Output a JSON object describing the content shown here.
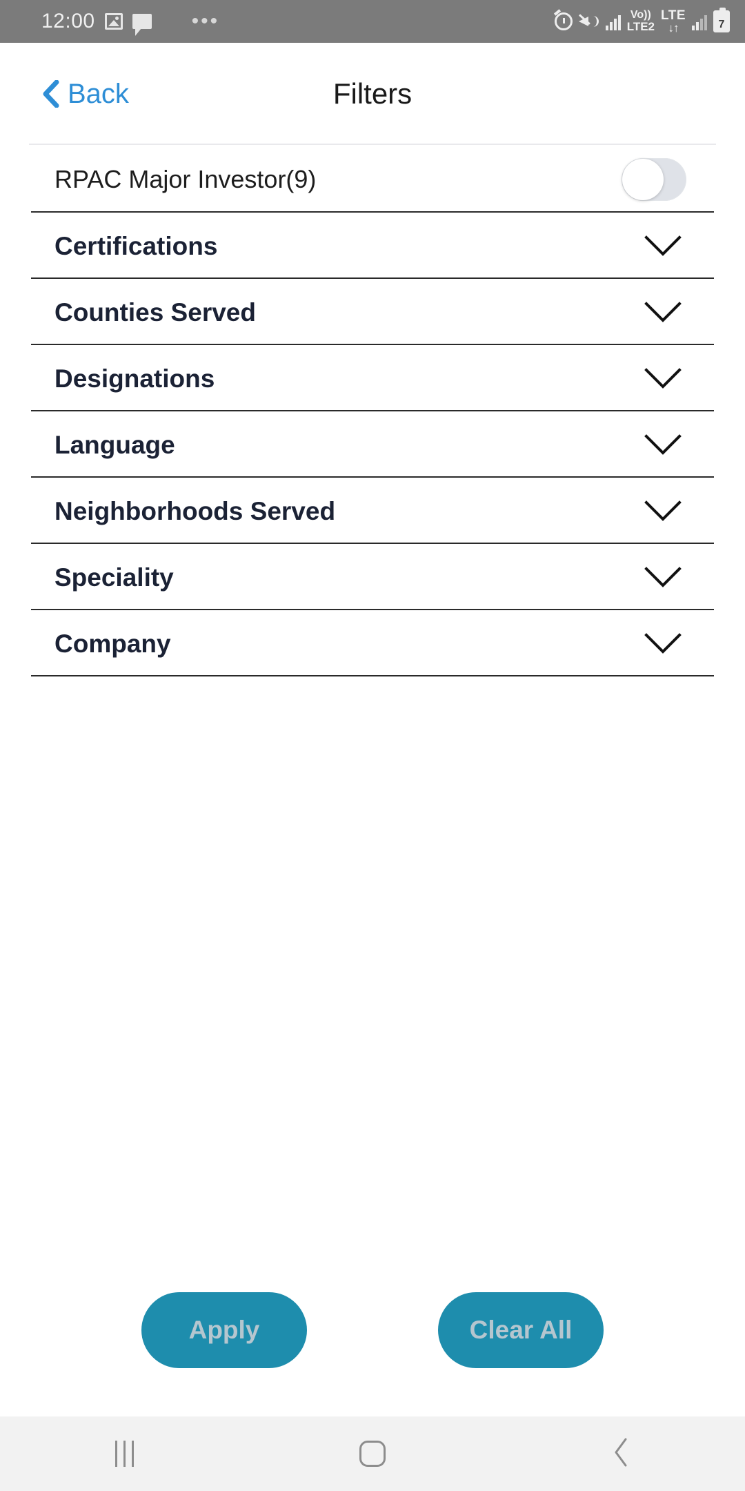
{
  "status_bar": {
    "time": "12:00",
    "left_icons": [
      "photo-icon",
      "chat-icon"
    ],
    "overflow": "•••",
    "right_icons": [
      "alarm-icon",
      "mute-vibrate-icon",
      "signal-bars-icon",
      "volte2-icon",
      "lte-data-icon",
      "signal-bars-2-icon",
      "battery-icon"
    ],
    "volte_top": "Vo))",
    "volte_bottom": "LTE2",
    "lte_label": "LTE",
    "lte_arrows": "↓↑",
    "battery_level": "7",
    "background": "#7b7b7b"
  },
  "header": {
    "back_label": "Back",
    "back_icon": "chevron-left-icon",
    "title": "Filters",
    "accent": "#2e8ed6"
  },
  "filters": {
    "toggle_row": {
      "label": "RPAC Major Investor(9)",
      "toggle_state": "off"
    },
    "sections": [
      {
        "label": "Certifications",
        "expanded": false
      },
      {
        "label": "Counties Served",
        "expanded": false
      },
      {
        "label": "Designations",
        "expanded": false
      },
      {
        "label": "Language",
        "expanded": false
      },
      {
        "label": "Neighborhoods Served",
        "expanded": false
      },
      {
        "label": "Speciality",
        "expanded": false
      },
      {
        "label": "Company",
        "expanded": false
      }
    ]
  },
  "actions": {
    "apply_label": "Apply",
    "clear_label": "Clear All",
    "button_color": "#1e8dad",
    "button_text_color": "#b5c6cf"
  },
  "nav_bar": {
    "recents": "recents-icon",
    "home": "home-icon",
    "back": "back-icon",
    "background": "#f2f2f2"
  }
}
